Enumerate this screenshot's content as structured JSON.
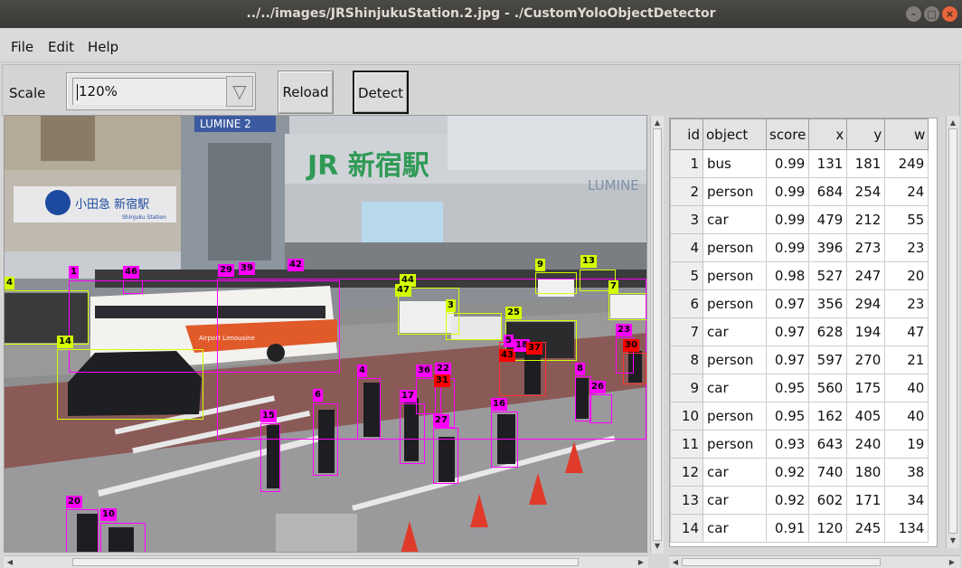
{
  "window": {
    "title": "../../images/JRShinjukuStation.2.jpg - ./CustomYoloObjectDetector"
  },
  "menu": {
    "file": "File",
    "edit": "Edit",
    "help": "Help"
  },
  "toolbar": {
    "scale_label": "Scale",
    "scale_value": "120%",
    "reload_label": "Reload",
    "detect_label": "Detect"
  },
  "scene_text": {
    "store_name": "小田急 新宿駅",
    "store_sub": "Shinjuku Station",
    "jr_sign": "JR 新宿駅",
    "lumine_left": "LUMINE 2",
    "lumine_right": "LUMINE",
    "bus_text": "Airport Limousine"
  },
  "colors": {
    "person": "#ff00ff",
    "car": "#d4ff00",
    "bus": "#ff00ff",
    "hi": "#ff0000"
  },
  "boxes": [
    {
      "label": "4",
      "cls": "car"
    },
    {
      "label": "1",
      "cls": "bus"
    },
    {
      "label": "46",
      "cls": "person"
    },
    {
      "label": "29",
      "cls": "person"
    },
    {
      "label": "39",
      "cls": "person"
    },
    {
      "label": "42",
      "cls": "person"
    },
    {
      "label": "44",
      "cls": "car"
    },
    {
      "label": "47",
      "cls": "car"
    },
    {
      "label": "3",
      "cls": "car"
    },
    {
      "label": "9",
      "cls": "car"
    },
    {
      "label": "13",
      "cls": "car"
    },
    {
      "label": "7",
      "cls": "car"
    },
    {
      "label": "25",
      "cls": "car"
    },
    {
      "label": "14",
      "cls": "car"
    },
    {
      "label": "23",
      "cls": "person"
    },
    {
      "label": "30",
      "cls": "hi"
    },
    {
      "label": "43",
      "cls": "hi"
    },
    {
      "label": "18",
      "cls": "person"
    },
    {
      "label": "5",
      "cls": "person"
    },
    {
      "label": "37",
      "cls": "hi"
    },
    {
      "label": "4",
      "cls": "person"
    },
    {
      "label": "36",
      "cls": "person"
    },
    {
      "label": "22",
      "cls": "person"
    },
    {
      "label": "31",
      "cls": "hi"
    },
    {
      "label": "6",
      "cls": "person"
    },
    {
      "label": "17",
      "cls": "person"
    },
    {
      "label": "16",
      "cls": "person"
    },
    {
      "label": "8",
      "cls": "person"
    },
    {
      "label": "26",
      "cls": "person"
    },
    {
      "label": "27",
      "cls": "person"
    },
    {
      "label": "15",
      "cls": "person"
    },
    {
      "label": "20",
      "cls": "person"
    },
    {
      "label": "10",
      "cls": "person"
    }
  ],
  "table": {
    "headers": [
      "id",
      "object",
      "score",
      "x",
      "y",
      "w"
    ],
    "rows": [
      [
        "1",
        "bus",
        "0.99",
        "131",
        "181",
        "249"
      ],
      [
        "2",
        "person",
        "0.99",
        "684",
        "254",
        "24"
      ],
      [
        "3",
        "car",
        "0.99",
        "479",
        "212",
        "55"
      ],
      [
        "4",
        "person",
        "0.99",
        "396",
        "273",
        "23"
      ],
      [
        "5",
        "person",
        "0.98",
        "527",
        "247",
        "20"
      ],
      [
        "6",
        "person",
        "0.97",
        "356",
        "294",
        "23"
      ],
      [
        "7",
        "car",
        "0.97",
        "628",
        "194",
        "47"
      ],
      [
        "8",
        "person",
        "0.97",
        "597",
        "270",
        "21"
      ],
      [
        "9",
        "car",
        "0.95",
        "560",
        "175",
        "40"
      ],
      [
        "10",
        "person",
        "0.95",
        "162",
        "405",
        "40"
      ],
      [
        "11",
        "person",
        "0.93",
        "643",
        "240",
        "19"
      ],
      [
        "12",
        "car",
        "0.92",
        "740",
        "180",
        "38"
      ],
      [
        "13",
        "car",
        "0.92",
        "602",
        "171",
        "34"
      ],
      [
        "14",
        "car",
        "0.91",
        "120",
        "245",
        "134"
      ]
    ]
  }
}
